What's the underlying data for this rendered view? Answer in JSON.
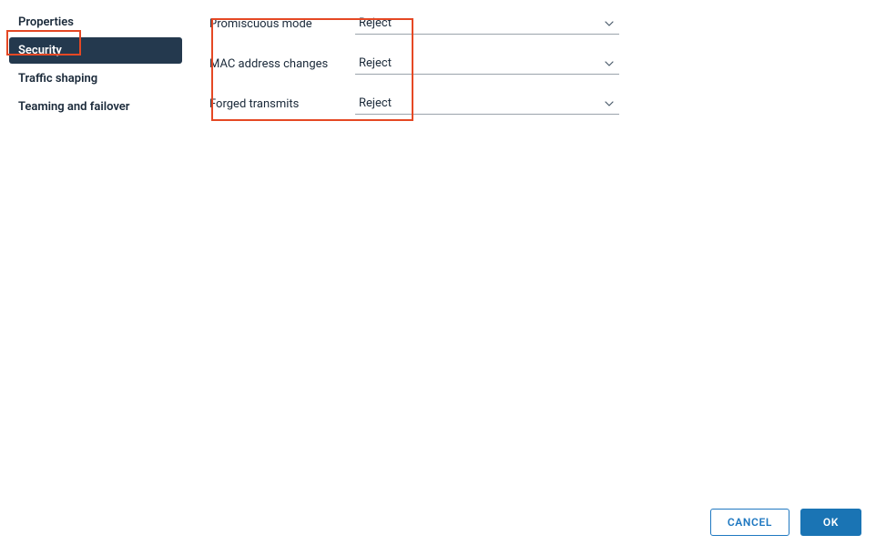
{
  "sidebar": {
    "items": [
      {
        "label": "Properties"
      },
      {
        "label": "Security"
      },
      {
        "label": "Traffic shaping"
      },
      {
        "label": "Teaming and failover"
      }
    ]
  },
  "form": {
    "promiscuous": {
      "label": "Promiscuous mode",
      "value": "Reject"
    },
    "mac_changes": {
      "label": "MAC address changes",
      "value": "Reject"
    },
    "forged_transmits": {
      "label": "Forged transmits",
      "value": "Reject"
    }
  },
  "footer": {
    "cancel": "CANCEL",
    "ok": "OK"
  }
}
